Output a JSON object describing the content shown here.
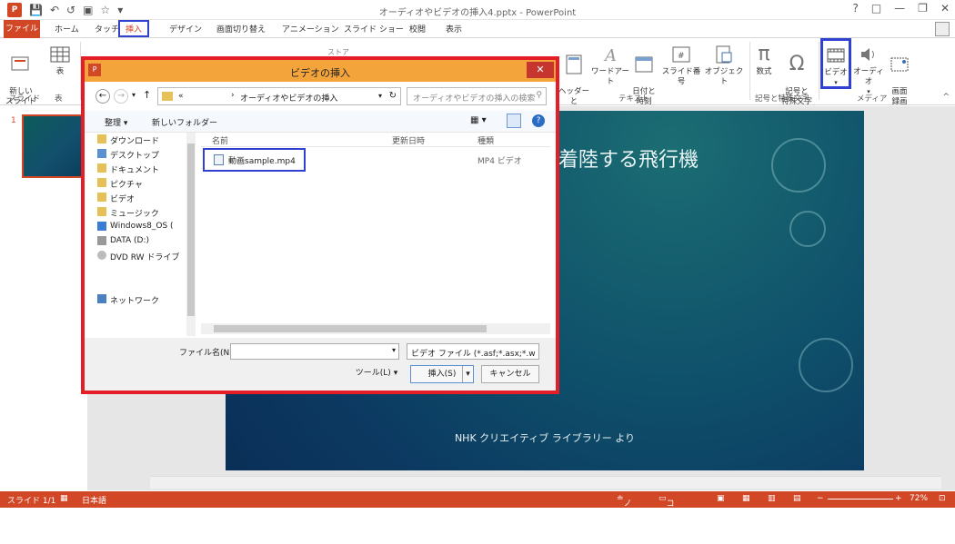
{
  "window": {
    "title": "オーディオやビデオの挿入4.pptx - PowerPoint"
  },
  "qat": {
    "logo": "P"
  },
  "tabs": [
    "ファイル",
    "ホーム",
    "タッチ",
    "挿入",
    "デザイン",
    "画面切り替え",
    "アニメーション",
    "スライド ショー",
    "校閲",
    "表示"
  ],
  "ribbon": {
    "new_slide": "新しい\nスライド",
    "table": "表",
    "group_slide": "スライド",
    "group_table": "表",
    "header_footer": "ヘッダーと\nフッター",
    "wordart": "ワードアート",
    "datetime": "日付と\n時刻",
    "slide_number": "スライド番号",
    "object": "オブジェクト",
    "group_text": "テキスト",
    "equation": "数式",
    "symbol": "記号と\n特殊文字",
    "group_symbols": "記号と特殊文字",
    "video": "ビデオ",
    "audio": "オーディオ",
    "screen_recording": "画面\n録画",
    "group_media": "メディア",
    "store": "ストア"
  },
  "dialog": {
    "title": "ビデオの挿入",
    "path_prefix": "«",
    "path": "オーディオやビデオの挿入",
    "search_placeholder": "オーディオやビデオの挿入の検索",
    "organize": "整理",
    "new_folder": "新しいフォルダー",
    "nav": [
      "ダウンロード",
      "デスクトップ",
      "ドキュメント",
      "ピクチャ",
      "ビデオ",
      "ミュージック",
      "Windows8_OS (",
      "DATA (D:)",
      "DVD RW ドライブ",
      "ネットワーク"
    ],
    "col_name": "名前",
    "col_date": "更新日時",
    "col_type": "種類",
    "file_name": "動画sample.mp4",
    "file_type": "MP4 ビデオ",
    "filename_label": "ファイル名(N):",
    "filetype_value": "ビデオ ファイル (*.asf;*.asx;*.w",
    "tools": "ツール(L)",
    "insert": "挿入(S)",
    "cancel": "キャンセル"
  },
  "slide": {
    "title": "着陸する飛行機",
    "credit": "NHK クリエイティブ ライブラリー より",
    "thumb_number": "1"
  },
  "status": {
    "slide": "スライド 1/1",
    "language": "日本語",
    "notes": "ノート",
    "comments": "コメント",
    "zoom": "72%"
  },
  "colors": {
    "accent": "#d24726",
    "highlight": "#3040d0",
    "dialog_border": "#e41e26"
  }
}
